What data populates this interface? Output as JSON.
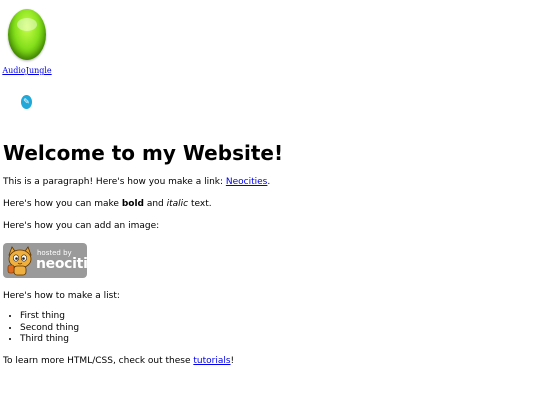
{
  "widget": {
    "link_text": "AudioJungle",
    "icon": "green-orb-icon",
    "small_icon": "pencil-badge-icon"
  },
  "page": {
    "heading": "Welcome to my Website!",
    "p1_text": "This is a paragraph! Here's how you make a link: ",
    "p1_link": "Neocities",
    "p1_end": ".",
    "p2_start": "Here's how you can make ",
    "p2_bold": "bold",
    "p2_mid": " and ",
    "p2_italic": "italic",
    "p2_end": " text.",
    "p3": "Here's how you can add an image:",
    "badge_hosted": "hosted by",
    "badge_brand": "neocities",
    "p4": "Here's how to make a list:",
    "list": [
      "First thing",
      "Second thing",
      "Third thing"
    ],
    "p5_start": "To learn more HTML/CSS, check out these ",
    "p5_link": "tutorials",
    "p5_end": "!"
  },
  "colors": {
    "link": "#0000ee",
    "badge_bg": "#9a9a9a",
    "orb": "#86e01c"
  }
}
